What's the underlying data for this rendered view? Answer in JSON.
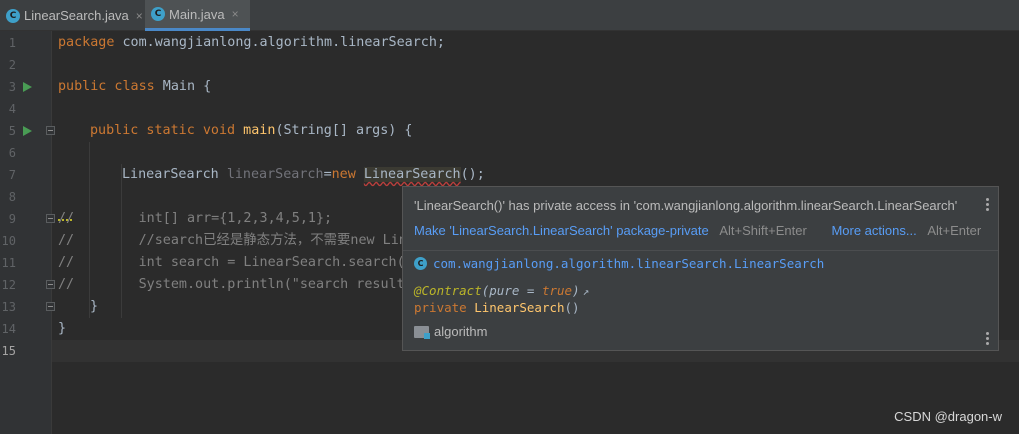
{
  "tabs": [
    {
      "label": "LinearSearch.java",
      "icon": "java-class-icon",
      "active": false
    },
    {
      "label": "Main.java",
      "icon": "java-class-icon",
      "active": true
    }
  ],
  "class_icon_glyph": "C",
  "close_glyph": "×",
  "editor": {
    "line_numbers": [
      "1",
      "2",
      "3",
      "4",
      "5",
      "6",
      "7",
      "8",
      "9",
      "10",
      "11",
      "12",
      "13",
      "14",
      "15"
    ],
    "code": {
      "l1_kw": "package",
      "l1_rest": " com.wangjianlong.algorithm.linearSearch;",
      "l3_kw": "public class",
      "l3_name": " Main {",
      "l5_kw": "public static void",
      "l5_fn": " main",
      "l5_rest": "(String[] args) {",
      "l7_type": "LinearSearch ",
      "l7_var": "linearSearch",
      "l7_eq": "=",
      "l7_new": "new",
      "l7_sp": " ",
      "l7_call": "LinearSearch",
      "l7_end": "();",
      "l9_c": "//",
      "l9_rest": "        int[] arr={1,2,3,4,5,1};",
      "l10": "//        //search已经是静态方法，不需要new Lin",
      "l11": "//        int search = LinearSearch.search(",
      "l12": "//        System.out.println(\"search result",
      "l13": "}",
      "l14": "}"
    }
  },
  "popup": {
    "message": "'LinearSearch()' has private access in 'com.wangjianlong.algorithm.linearSearch.LinearSearch'",
    "fix_label": "Make 'LinearSearch.LinearSearch' package-private",
    "fix_shortcut": "Alt+Shift+Enter",
    "more_label": "More actions...",
    "more_shortcut": "Alt+Enter",
    "class_fqn": "com.wangjianlong.algorithm.linearSearch.LinearSearch",
    "annotation": "@Contract",
    "annotation_open": "(",
    "annotation_param": "pure = ",
    "annotation_value": "true",
    "annotation_close": ")",
    "annotation_arrow": "↗",
    "signature_kw": "private",
    "signature_sp": " ",
    "signature_name": "LinearSearch",
    "signature_parens": "()",
    "module": "algorithm"
  },
  "watermark": "CSDN @dragon-w",
  "colors": {
    "background": "#2b2b2b",
    "keyword": "#cc7832",
    "method": "#ffc66d",
    "link": "#589df6",
    "run_gutter": "#499c54",
    "error_underline": "#bc3f3c"
  }
}
